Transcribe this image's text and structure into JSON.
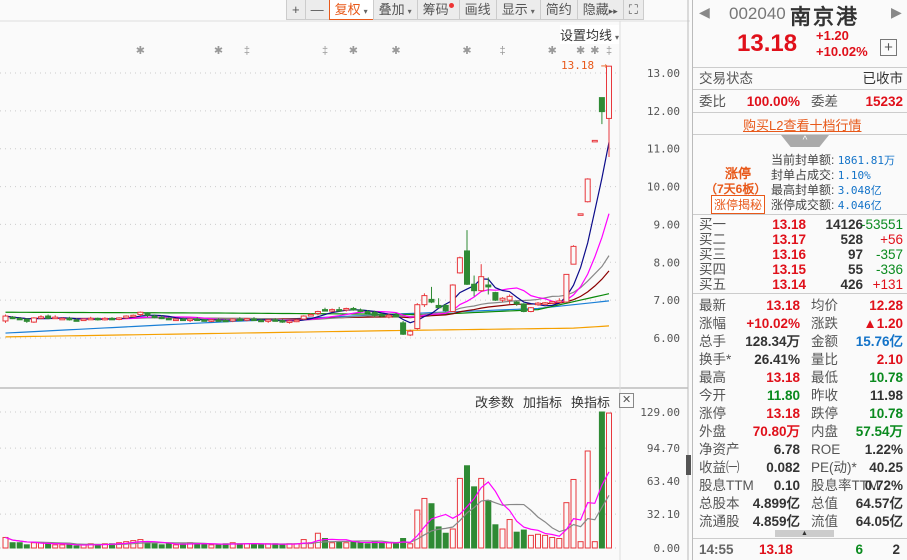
{
  "toolbar": {
    "items": [
      {
        "label": "+"
      },
      {
        "label": "—"
      },
      {
        "label": "复权",
        "active": true,
        "caret": "▾"
      },
      {
        "label": "叠加",
        "caret": "▾"
      },
      {
        "label": "筹码",
        "dot": true
      },
      {
        "label": "画线"
      },
      {
        "label": "显示",
        "caret": "▾"
      },
      {
        "label": "简约"
      },
      {
        "label": "隐藏",
        "suffix": "▸▸"
      },
      {
        "label": "⛶"
      }
    ]
  },
  "main": {
    "set_ma_label": "设置均线",
    "set_ma_caret": "▾",
    "limit_price_label": "13.18",
    "limit_arrow": "→"
  },
  "volume_panel": {
    "buttons": [
      "改参数",
      "加指标",
      "换指标"
    ],
    "close": "✕"
  },
  "chart_data": {
    "type": "candlestick",
    "price_axis": {
      "ticks": [
        "13.00",
        "12.00",
        "11.00",
        "10.00",
        "9.00",
        "8.00",
        "7.00",
        "6.00"
      ],
      "ylim": [
        6,
        13
      ]
    },
    "volume_axis": {
      "ticks": [
        "129.00",
        "94.70",
        "63.40",
        "32.10",
        "0.00"
      ],
      "ylim": [
        0,
        129
      ]
    },
    "colors": {
      "up": "#e8383d",
      "down": "#2f8a34",
      "ma5": "#0b0b8a",
      "ma10": "#f0f",
      "ma20": "#888",
      "ma30": "#8b0000",
      "ma60": "#0a8a0a",
      "ma120": "#1a7fd6",
      "ma250": "#f5a000",
      "vma5": "#f0f",
      "vma10": "#888"
    },
    "ohlcv": [
      [
        6.45,
        6.62,
        6.4,
        6.58,
        10
      ],
      [
        6.55,
        6.58,
        6.5,
        6.52,
        5
      ],
      [
        6.52,
        6.55,
        6.48,
        6.5,
        5
      ],
      [
        6.5,
        6.52,
        6.4,
        6.44,
        3
      ],
      [
        6.42,
        6.55,
        6.4,
        6.53,
        5
      ],
      [
        6.52,
        6.6,
        6.5,
        6.56,
        5
      ],
      [
        6.58,
        6.62,
        6.5,
        6.52,
        4
      ],
      [
        6.55,
        6.6,
        6.52,
        6.55,
        3
      ],
      [
        6.5,
        6.55,
        6.48,
        6.52,
        3
      ],
      [
        6.52,
        6.56,
        6.46,
        6.48,
        3
      ],
      [
        6.48,
        6.52,
        6.45,
        6.47,
        2
      ],
      [
        6.48,
        6.52,
        6.45,
        6.5,
        3
      ],
      [
        6.5,
        6.56,
        6.48,
        6.52,
        4
      ],
      [
        6.52,
        6.54,
        6.46,
        6.48,
        3
      ],
      [
        6.48,
        6.55,
        6.46,
        6.52,
        4
      ],
      [
        6.52,
        6.55,
        6.48,
        6.5,
        4
      ],
      [
        6.5,
        6.55,
        6.47,
        6.53,
        5
      ],
      [
        6.53,
        6.6,
        6.5,
        6.58,
        6
      ],
      [
        6.6,
        6.62,
        6.55,
        6.6,
        7
      ],
      [
        6.62,
        6.7,
        6.58,
        6.68,
        8
      ],
      [
        6.66,
        6.68,
        6.55,
        6.6,
        5
      ],
      [
        6.58,
        6.62,
        6.52,
        6.55,
        4
      ],
      [
        6.55,
        6.6,
        6.5,
        6.53,
        3
      ],
      [
        6.52,
        6.55,
        6.48,
        6.5,
        4
      ],
      [
        6.48,
        6.52,
        6.45,
        6.5,
        3
      ],
      [
        6.5,
        6.54,
        6.46,
        6.47,
        4
      ],
      [
        6.47,
        6.52,
        6.42,
        6.5,
        5
      ],
      [
        6.5,
        6.55,
        6.45,
        6.48,
        4
      ],
      [
        6.48,
        6.5,
        6.44,
        6.46,
        4
      ],
      [
        6.45,
        6.5,
        6.42,
        6.48,
        3
      ],
      [
        6.48,
        6.52,
        6.45,
        6.47,
        3
      ],
      [
        6.47,
        6.5,
        6.43,
        6.45,
        4
      ],
      [
        6.45,
        6.52,
        6.42,
        6.5,
        5
      ],
      [
        6.5,
        6.55,
        6.46,
        6.48,
        4
      ],
      [
        6.48,
        6.52,
        6.44,
        6.51,
        4
      ],
      [
        6.5,
        6.55,
        6.45,
        6.47,
        4
      ],
      [
        6.47,
        6.5,
        6.42,
        6.45,
        3
      ],
      [
        6.45,
        6.5,
        6.4,
        6.48,
        4
      ],
      [
        6.48,
        6.52,
        6.44,
        6.46,
        4
      ],
      [
        6.46,
        6.5,
        6.4,
        6.42,
        3
      ],
      [
        6.42,
        6.48,
        6.38,
        6.45,
        4
      ],
      [
        6.45,
        6.5,
        6.42,
        6.47,
        4
      ],
      [
        6.5,
        6.6,
        6.48,
        6.58,
        8
      ],
      [
        6.6,
        6.65,
        6.58,
        6.62,
        5
      ],
      [
        6.65,
        6.72,
        6.6,
        6.7,
        14
      ],
      [
        6.75,
        6.8,
        6.7,
        6.72,
        9
      ],
      [
        6.72,
        6.78,
        6.68,
        6.75,
        5
      ],
      [
        6.75,
        6.82,
        6.7,
        6.72,
        6
      ],
      [
        6.74,
        6.8,
        6.7,
        6.78,
        5
      ],
      [
        6.78,
        6.82,
        6.72,
        6.74,
        6
      ],
      [
        6.74,
        6.78,
        6.68,
        6.72,
        5
      ],
      [
        6.7,
        6.74,
        6.62,
        6.66,
        4
      ],
      [
        6.68,
        6.72,
        6.55,
        6.6,
        6
      ],
      [
        6.62,
        6.66,
        6.55,
        6.58,
        5
      ],
      [
        6.58,
        6.64,
        6.52,
        6.6,
        5
      ],
      [
        6.6,
        6.66,
        6.55,
        6.56,
        4
      ],
      [
        6.4,
        6.45,
        6.08,
        6.1,
        9
      ],
      [
        6.08,
        6.22,
        6.05,
        6.18,
        4
      ],
      [
        6.25,
        6.92,
        6.22,
        6.88,
        36
      ],
      [
        6.88,
        7.18,
        6.82,
        7.12,
        47
      ],
      [
        7.02,
        7.35,
        6.92,
        6.95,
        42
      ],
      [
        6.86,
        7.05,
        6.8,
        6.8,
        20
      ],
      [
        6.86,
        6.9,
        6.7,
        6.72,
        14
      ],
      [
        6.7,
        7.42,
        6.68,
        7.4,
        18
      ],
      [
        7.72,
        8.15,
        7.7,
        8.12,
        66
      ],
      [
        8.3,
        8.85,
        7.4,
        7.42,
        78
      ],
      [
        7.42,
        7.65,
        7.1,
        7.25,
        58
      ],
      [
        7.25,
        7.95,
        7.22,
        7.62,
        66
      ],
      [
        7.4,
        7.6,
        7.15,
        7.35,
        45
      ],
      [
        7.2,
        7.22,
        6.98,
        7.0,
        22
      ],
      [
        7.0,
        7.08,
        6.95,
        7.05,
        18
      ],
      [
        7.0,
        7.15,
        6.9,
        7.1,
        27
      ],
      [
        6.95,
        6.98,
        6.85,
        6.9,
        15
      ],
      [
        6.9,
        6.92,
        6.68,
        6.7,
        17
      ],
      [
        6.7,
        6.82,
        6.68,
        6.8,
        12
      ],
      [
        6.88,
        6.95,
        6.85,
        6.92,
        13
      ],
      [
        6.9,
        6.95,
        6.88,
        6.93,
        12
      ],
      [
        6.93,
        6.98,
        6.9,
        6.96,
        10
      ],
      [
        6.96,
        7.05,
        6.95,
        6.98,
        9
      ],
      [
        6.95,
        7.68,
        6.95,
        7.68,
        43
      ],
      [
        7.95,
        8.45,
        7.95,
        8.42,
        65
      ],
      [
        9.28,
        9.28,
        9.28,
        9.28,
        6
      ],
      [
        9.6,
        10.22,
        9.58,
        10.2,
        92
      ],
      [
        11.22,
        11.22,
        11.22,
        11.22,
        6
      ],
      [
        12.35,
        12.35,
        11.65,
        11.98,
        129
      ],
      [
        11.8,
        13.18,
        10.78,
        13.18,
        128
      ]
    ],
    "long_ma": {
      "ma60": [
        [
          0,
          6.68
        ],
        [
          30,
          6.66
        ],
        [
          60,
          6.62
        ],
        [
          75,
          6.75
        ],
        [
          85,
          7.17
        ]
      ],
      "ma120": [
        [
          0,
          6.13
        ],
        [
          30,
          6.42
        ],
        [
          56,
          6.64
        ],
        [
          75,
          6.78
        ],
        [
          85,
          6.98
        ]
      ],
      "ma250": [
        [
          0,
          6.03
        ],
        [
          56,
          6.2
        ],
        [
          80,
          6.26
        ],
        [
          85,
          6.32
        ]
      ]
    },
    "event_markers": [
      [
        19,
        "✱"
      ],
      [
        30,
        "✱"
      ],
      [
        34,
        "‡"
      ],
      [
        45,
        "‡"
      ],
      [
        49,
        "✱"
      ],
      [
        55,
        "✱"
      ],
      [
        65,
        "✱"
      ],
      [
        70,
        "‡"
      ],
      [
        77,
        "✱"
      ],
      [
        81,
        "✱"
      ],
      [
        83,
        "✱"
      ],
      [
        85,
        "‡"
      ]
    ]
  },
  "quote": {
    "code": "002040",
    "name": "南京港",
    "price": "13.18",
    "change": "+1.20",
    "change_pct": "+10.02%",
    "add": "+",
    "status_label": "交易状态",
    "status_value": "已收市",
    "wb_label": "委比",
    "wb_value": "100.00%",
    "wc_label": "委差",
    "wc_value": "15232",
    "l2_link": "购买L2查看十档行情",
    "limit": {
      "title": "涨停",
      "days": "（7天6板）",
      "reveal_btn": "涨停揭秘",
      "rows": [
        {
          "k": "当前封单额:",
          "v": "1861.81万"
        },
        {
          "k": "封单占成交:",
          "v": "1.10%"
        },
        {
          "k": "最高封单额:",
          "v": "3.048亿"
        },
        {
          "k": "涨停成交额:",
          "v": "4.046亿"
        }
      ]
    },
    "bids": [
      {
        "l": "买一",
        "p": "13.18",
        "q": "14126",
        "d": "-53551",
        "up": false
      },
      {
        "l": "买二",
        "p": "13.17",
        "q": "528",
        "d": "+56",
        "up": true
      },
      {
        "l": "买三",
        "p": "13.16",
        "q": "97",
        "d": "-357",
        "up": false
      },
      {
        "l": "买四",
        "p": "13.15",
        "q": "55",
        "d": "-336",
        "up": false
      },
      {
        "l": "买五",
        "p": "13.14",
        "q": "426",
        "d": "+131",
        "up": true
      }
    ],
    "stats": [
      [
        {
          "k": "最新",
          "v": "13.18",
          "c": "red"
        },
        {
          "k": "均价",
          "v": "12.28",
          "c": "red"
        }
      ],
      [
        {
          "k": "涨幅",
          "v": "+10.02%",
          "c": "red"
        },
        {
          "k": "涨跌",
          "v": "▲1.20",
          "c": "red"
        }
      ],
      [
        {
          "k": "总手",
          "v": "128.34万",
          "c": "dk"
        },
        {
          "k": "金额",
          "v": "15.76亿",
          "c": "blu"
        }
      ],
      [
        {
          "k": "换手*",
          "v": "26.41%",
          "c": "dk"
        },
        {
          "k": "量比",
          "v": "2.10",
          "c": "red"
        }
      ],
      [
        {
          "k": "最高",
          "v": "13.18",
          "c": "red"
        },
        {
          "k": "最低",
          "v": "10.78",
          "c": "grn"
        }
      ],
      [
        {
          "k": "今开",
          "v": "11.80",
          "c": "grn"
        },
        {
          "k": "昨收",
          "v": "11.98",
          "c": "dk"
        }
      ],
      [
        {
          "k": "涨停",
          "v": "13.18",
          "c": "red"
        },
        {
          "k": "跌停",
          "v": "10.78",
          "c": "grn"
        }
      ],
      [
        {
          "k": "外盘",
          "v": "70.80万",
          "c": "red"
        },
        {
          "k": "内盘",
          "v": "57.54万",
          "c": "grn"
        }
      ],
      [
        {
          "k": "净资产",
          "v": "6.78",
          "c": "dk"
        },
        {
          "k": "ROE",
          "v": "1.22%",
          "c": "dk"
        }
      ],
      [
        {
          "k": "收益㈠",
          "v": "0.082",
          "c": "dk"
        },
        {
          "k": "PE(动)*",
          "v": "40.25",
          "c": "dk"
        }
      ],
      [
        {
          "k": "股息TTM",
          "v": "0.10",
          "c": "dk"
        },
        {
          "k": "股息率TTM",
          "v": "0.72%",
          "c": "dk"
        }
      ],
      [
        {
          "k": "总股本",
          "v": "4.899亿",
          "c": "dk"
        },
        {
          "k": "总值",
          "v": "64.57亿",
          "c": "dk"
        }
      ],
      [
        {
          "k": "流通股",
          "v": "4.859亿",
          "c": "dk"
        },
        {
          "k": "流值",
          "v": "64.05亿",
          "c": "dk"
        }
      ]
    ],
    "tick": {
      "time": "14:55",
      "price": "13.18",
      "vol": "6",
      "n": "2"
    }
  }
}
